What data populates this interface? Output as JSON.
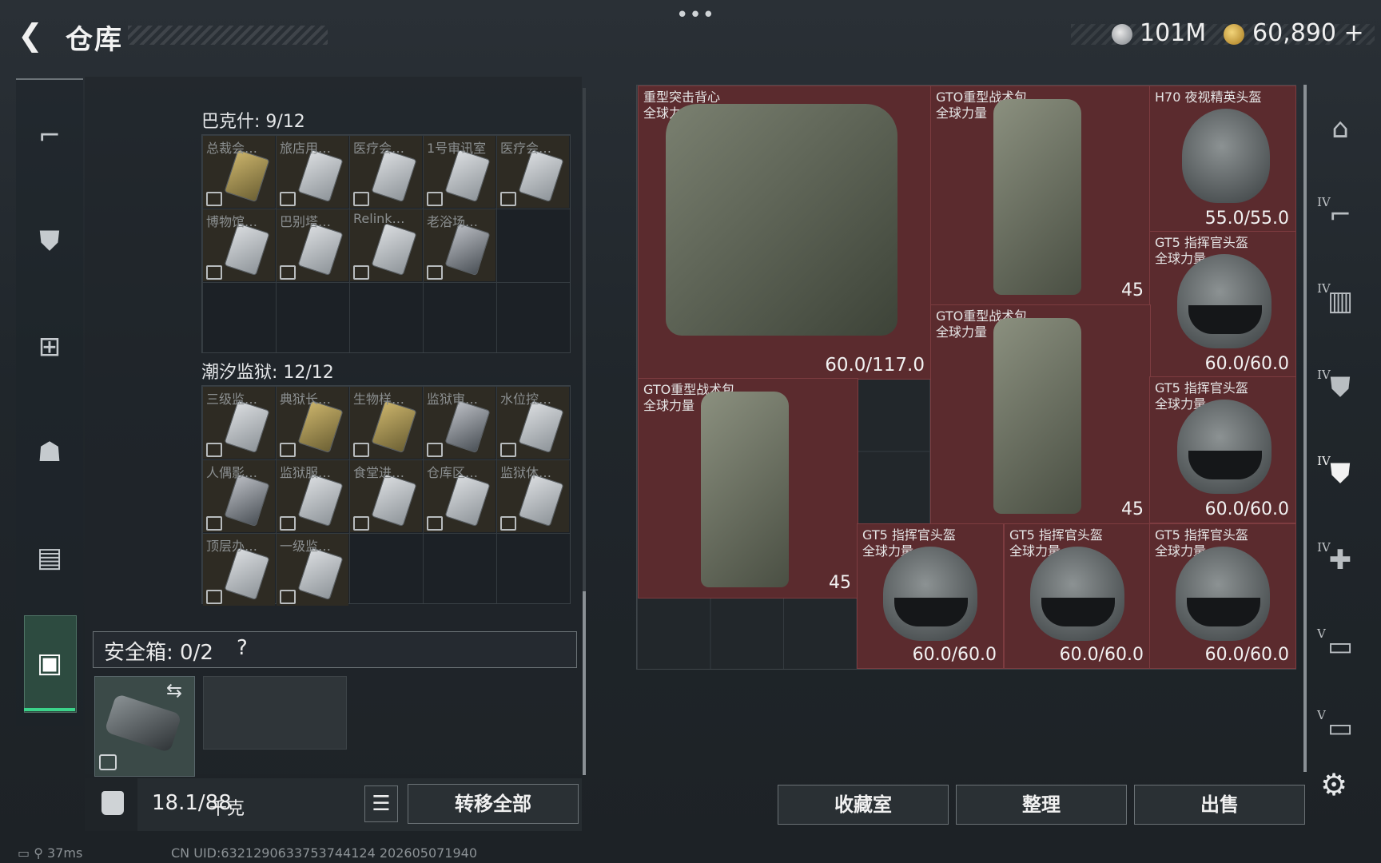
{
  "header": {
    "back_icon": "back-arrow-icon",
    "title": "仓库",
    "menu_dots": "•••",
    "currency_silver": "101M",
    "currency_gold": "60,890",
    "currency_add": "+"
  },
  "left_sidebar": {
    "items": [
      {
        "icon": "gun-icon",
        "glyph": "⌐"
      },
      {
        "icon": "armor-vest-icon",
        "glyph": "⛊"
      },
      {
        "icon": "chest-rig-icon",
        "glyph": "⊞"
      },
      {
        "icon": "backpack-icon",
        "glyph": "☗"
      },
      {
        "icon": "container-icon",
        "glyph": "▤"
      },
      {
        "icon": "briefcase-icon",
        "glyph": "▣"
      }
    ],
    "accent": "#3bd38a"
  },
  "stash": {
    "sections": [
      {
        "title": "巴克什: 9/12",
        "cards": [
          {
            "label": "总裁会…",
            "style": "gold"
          },
          {
            "label": "旅店用…",
            "style": "plain"
          },
          {
            "label": "医疗会…",
            "style": "plain"
          },
          {
            "label": "1号审讯室",
            "style": "plain"
          },
          {
            "label": "医疗会…",
            "style": "plain"
          },
          {
            "label": "博物馆…",
            "style": "plain"
          },
          {
            "label": "巴别塔…",
            "style": "plain"
          },
          {
            "label": "Relink…",
            "style": "plain"
          },
          {
            "label": "老浴场…",
            "style": "dark"
          }
        ]
      },
      {
        "title": "潮汐监狱: 12/12",
        "cards": [
          {
            "label": "三级监…",
            "style": "plain"
          },
          {
            "label": "典狱长…",
            "style": "gold"
          },
          {
            "label": "生物样…",
            "style": "gold"
          },
          {
            "label": "监狱审…",
            "style": "dark"
          },
          {
            "label": "水位控…",
            "style": "plain"
          },
          {
            "label": "人偶影…",
            "style": "dark"
          },
          {
            "label": "监狱服…",
            "style": "plain"
          },
          {
            "label": "食堂进…",
            "style": "plain"
          },
          {
            "label": "仓库区…",
            "style": "plain"
          },
          {
            "label": "监狱休…",
            "style": "plain"
          },
          {
            "label": "顶层办…",
            "style": "plain"
          },
          {
            "label": "一级监…",
            "style": "plain"
          }
        ]
      }
    ],
    "safe_box": {
      "label": "安全箱: 0/2",
      "help": "?",
      "swap_icon": "⇆"
    },
    "weight": {
      "value": "18.1/88",
      "unit": "千克"
    },
    "list_icon": "☰",
    "transfer_all": "转移全部"
  },
  "inventory": {
    "items": [
      {
        "name": "重型突击背心\n全球力量",
        "value": "60.0/117.0",
        "kind": "vest"
      },
      {
        "name": "GTO重型战术包\n全球力量",
        "value": "45",
        "kind": "pack"
      },
      {
        "name": "H70 夜视精英头盔",
        "value": "55.0/55.0",
        "kind": "nvg-helmet"
      },
      {
        "name": "GT5 指挥官头盔\n全球力量",
        "value": "60.0/60.0",
        "kind": "helmet"
      },
      {
        "name": "GTO重型战术包\n全球力量",
        "value": "45",
        "kind": "pack"
      },
      {
        "name": "GT5 指挥官头盔\n全球力量",
        "value": "60.0/60.0",
        "kind": "helmet"
      },
      {
        "name": "GTO重型战术包\n全球力量",
        "value": "45",
        "kind": "pack"
      },
      {
        "name": "GT5 指挥官头盔\n全球力量",
        "value": "60.0/60.0",
        "kind": "helmet"
      },
      {
        "name": "GT5 指挥官头盔\n全球力量",
        "value": "60.0/60.0",
        "kind": "helmet"
      },
      {
        "name": "GT5 指挥官头盔\n全球力量",
        "value": "60.0/60.0",
        "kind": "helmet"
      }
    ],
    "item_bg": "#5b2b2e"
  },
  "right_sidebar": {
    "filters": [
      {
        "icon": "helmet-filter-icon",
        "level": ""
      },
      {
        "icon": "gun-filter-icon",
        "level": "IV"
      },
      {
        "icon": "mag-filter-icon",
        "level": "IV"
      },
      {
        "icon": "armor-filter-icon",
        "level": "IV"
      },
      {
        "icon": "armor-lock-filter-icon",
        "level": "IV"
      },
      {
        "icon": "medkit-filter-icon",
        "level": "IV"
      },
      {
        "icon": "key-filter-icon",
        "level": "V"
      },
      {
        "icon": "key2-filter-icon",
        "level": "V"
      }
    ]
  },
  "bottom_buttons": {
    "collection": "收藏室",
    "sort": "整理",
    "sell": "出售"
  },
  "status": {
    "ping": "37ms",
    "uid": "CN UID:6321290633753744124 202605071940"
  }
}
